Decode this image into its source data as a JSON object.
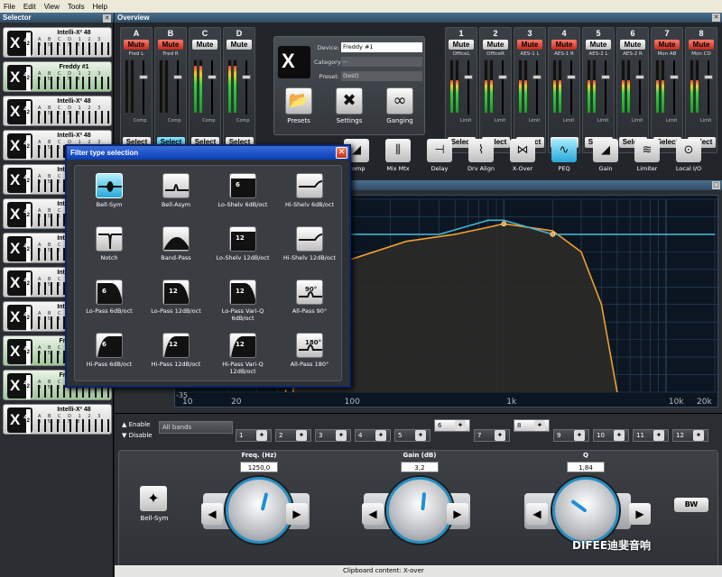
{
  "menu": [
    "File",
    "Edit",
    "View",
    "Tools",
    "Help"
  ],
  "selector": {
    "title": "Selector",
    "items": [
      {
        "name": "Intelli-X² 48",
        "active": false
      },
      {
        "name": "Freddy #1",
        "active": true
      },
      {
        "name": "Intelli-X² 48",
        "active": false
      },
      {
        "name": "Intelli-X² 48",
        "active": false
      },
      {
        "name": "Intelli-X² 48",
        "active": false
      },
      {
        "name": "Intelli-X² 48",
        "active": false
      },
      {
        "name": "Intelli-X² 48",
        "active": false
      },
      {
        "name": "Intelli-X² 48",
        "active": false
      },
      {
        "name": "Intelli-X² 48",
        "active": false
      },
      {
        "name": "Freddy #2",
        "active": true
      },
      {
        "name": "Freddy #3",
        "active": true
      },
      {
        "name": "Intelli-X² 48",
        "active": false
      }
    ],
    "logo_text": "X",
    "logo_sub": "48",
    "logo_sup": "2",
    "channels_text": "A B C D 1 2 3 4 5 6 7 8"
  },
  "overview": {
    "title": "Overview",
    "inputs": [
      {
        "label": "A",
        "name": "Fred L",
        "mute": true,
        "level": 0.0,
        "select_active": false
      },
      {
        "label": "B",
        "name": "Fred R",
        "mute": true,
        "level": 0.0,
        "select_active": true
      },
      {
        "label": "C",
        "name": "",
        "mute": false,
        "level": 0.9,
        "select_active": false
      },
      {
        "label": "D",
        "name": "",
        "mute": false,
        "level": 0.9,
        "select_active": false
      }
    ],
    "outputs": [
      {
        "label": "1",
        "name": "OfficeL",
        "mute": false,
        "level": 0.62
      },
      {
        "label": "2",
        "name": "OfficeR",
        "mute": false,
        "level": 0.62
      },
      {
        "label": "3",
        "name": "AES-1 L",
        "mute": true,
        "level": 0.62
      },
      {
        "label": "4",
        "name": "AES-1 R",
        "mute": true,
        "level": 0.62
      },
      {
        "label": "5",
        "name": "AES-2 L",
        "mute": false,
        "level": 0.62
      },
      {
        "label": "6",
        "name": "AES-2 R",
        "mute": false,
        "level": 0.62
      },
      {
        "label": "7",
        "name": "Mon AB",
        "mute": true,
        "level": 0.62
      },
      {
        "label": "8",
        "name": "Mon CD",
        "mute": true,
        "level": 0.62
      }
    ],
    "mute_label": "Mute",
    "select_label": "Select",
    "comp_label": "Comp",
    "limit_label": "Limit",
    "device": {
      "device_label": "Device:",
      "device_value": "Freddy #1",
      "category_label": "Category:",
      "category_value": "--",
      "preset_label": "Preset:",
      "preset_value": "(test)",
      "buttons": [
        {
          "label": "Presets",
          "icon": "folder-icon"
        },
        {
          "label": "Settings",
          "icon": "tools-icon"
        },
        {
          "label": "Ganging",
          "icon": "link-icon"
        }
      ]
    },
    "tools": [
      {
        "label": "Comp",
        "icon": "comp-icon",
        "active": false
      },
      {
        "label": "Mix Mtx",
        "icon": "mixer-icon",
        "active": false
      },
      {
        "label": "Delay",
        "icon": "delay-icon",
        "active": false
      },
      {
        "label": "Drv Align",
        "icon": "align-icon",
        "active": false
      },
      {
        "label": "X-Over",
        "icon": "xover-icon",
        "active": false
      },
      {
        "label": "PEQ",
        "icon": "peq-icon",
        "active": true
      },
      {
        "label": "Gain",
        "icon": "gain-icon",
        "active": false
      },
      {
        "label": "Limiter",
        "icon": "limiter-icon",
        "active": false
      },
      {
        "label": "Local I/O",
        "icon": "io-icon",
        "active": false
      }
    ]
  },
  "graph": {
    "x_ticks": [
      "10",
      "20",
      "100",
      "1k",
      "10k",
      "20k"
    ],
    "y_bottom": "-35"
  },
  "chart_data": {
    "type": "line",
    "x_scale": "log",
    "xlim": [
      10,
      20000
    ],
    "x_ticks": [
      "10",
      "20",
      "100",
      "1k",
      "10k",
      "20k"
    ],
    "y_bottom_label": "-35",
    "grid": true,
    "series": [
      {
        "color": "#f0a030",
        "style": "solid",
        "points": [
          [
            50,
            -35
          ],
          [
            58,
            -18
          ],
          [
            72,
            -5
          ],
          [
            100,
            2
          ],
          [
            250,
            8
          ],
          [
            500,
            10
          ],
          [
            800,
            12
          ],
          [
            1000,
            13
          ],
          [
            2000,
            11
          ],
          [
            3000,
            5
          ],
          [
            4000,
            -10
          ],
          [
            5000,
            -35
          ]
        ]
      },
      {
        "color": "#f0a030",
        "style": "dashed",
        "points": [
          [
            45,
            -35
          ],
          [
            55,
            -10
          ],
          [
            70,
            0
          ],
          [
            100,
            2
          ]
        ]
      },
      {
        "color": "#4ab0d0",
        "style": "solid",
        "points": [
          [
            10,
            10
          ],
          [
            400,
            10
          ],
          [
            800,
            14
          ],
          [
            1000,
            14
          ],
          [
            2000,
            10
          ],
          [
            20000,
            10
          ]
        ]
      }
    ],
    "markers": [
      {
        "x": 100,
        "y": 2,
        "label": "1"
      },
      {
        "x": 1000,
        "y": 13,
        "label": "2"
      },
      {
        "x": 2000,
        "y": 10,
        "label": "3"
      }
    ]
  },
  "bands": {
    "enable": "Enable",
    "disable": "Disable",
    "all_bands": "All bands",
    "items": [
      {
        "n": "1",
        "raised": false
      },
      {
        "n": "2",
        "raised": false
      },
      {
        "n": "3",
        "raised": false
      },
      {
        "n": "4",
        "raised": false
      },
      {
        "n": "5",
        "raised": false
      },
      {
        "n": "6",
        "raised": true
      },
      {
        "n": "7",
        "raised": false
      },
      {
        "n": "8",
        "raised": true
      },
      {
        "n": "9",
        "raised": false
      },
      {
        "n": "10",
        "raised": false
      },
      {
        "n": "11",
        "raised": false
      },
      {
        "n": "12",
        "raised": false
      }
    ],
    "bell_label": "Bell-Sym",
    "freq": {
      "title": "Freq. (Hz)",
      "value": "1250,0",
      "level": 0.55
    },
    "gain": {
      "title": "Gain (dB)",
      "value": "3,2",
      "level": 0.52
    },
    "q": {
      "title": "Q",
      "value": "1,84",
      "level": 0.3
    },
    "bw_label": "BW"
  },
  "dialog": {
    "title": "Filter type selection",
    "close": "✕",
    "filters": [
      {
        "label": "Bell-Sym",
        "icon": "bell-sym-icon",
        "active": true,
        "num": ""
      },
      {
        "label": "Bell-Asym",
        "icon": "bell-asym-icon",
        "active": false,
        "num": ""
      },
      {
        "label": "Lo-Shelv 6dB/oct",
        "icon": "lo-shelf-icon",
        "active": false,
        "num": "6"
      },
      {
        "label": "Hi-Shelv 6dB/oct",
        "icon": "hi-shelf-icon",
        "active": false,
        "num": ""
      },
      {
        "label": "Notch",
        "icon": "notch-icon",
        "active": false,
        "num": ""
      },
      {
        "label": "Band-Pass",
        "icon": "bandpass-icon",
        "active": false,
        "num": ""
      },
      {
        "label": "Lo-Shelv 12dB/oct",
        "icon": "lo-shelf-12-icon",
        "active": false,
        "num": "12"
      },
      {
        "label": "Hi-Shelv 12dB/oct",
        "icon": "hi-shelf-12-icon",
        "active": false,
        "num": ""
      },
      {
        "label": "Lo-Pass 6dB/oct",
        "icon": "lowpass-6-icon",
        "active": false,
        "num": "6"
      },
      {
        "label": "Lo-Pass 12dB/oct",
        "icon": "lowpass-12-icon",
        "active": false,
        "num": "12"
      },
      {
        "label": "Lo-Pass Vari-Q 6dB/oct",
        "icon": "lowpass-variq-icon",
        "active": false,
        "num": "12"
      },
      {
        "label": "All-Pass 90°",
        "icon": "allpass-90-icon",
        "active": false,
        "num": "90°"
      },
      {
        "label": "Hi-Pass 6dB/oct",
        "icon": "highpass-6-icon",
        "active": false,
        "num": "6"
      },
      {
        "label": "Hi-Pass 12dB/oct",
        "icon": "highpass-12-icon",
        "active": false,
        "num": "12"
      },
      {
        "label": "Hi-Pass Vari-Q 12dB/oct",
        "icon": "highpass-variq-icon",
        "active": false,
        "num": "12"
      },
      {
        "label": "All-Pass 180°",
        "icon": "allpass-180-icon",
        "active": false,
        "num": "180°"
      }
    ]
  },
  "statusbar": "Clipboard content: X-over",
  "watermark": "DIFEE迪斐音响"
}
